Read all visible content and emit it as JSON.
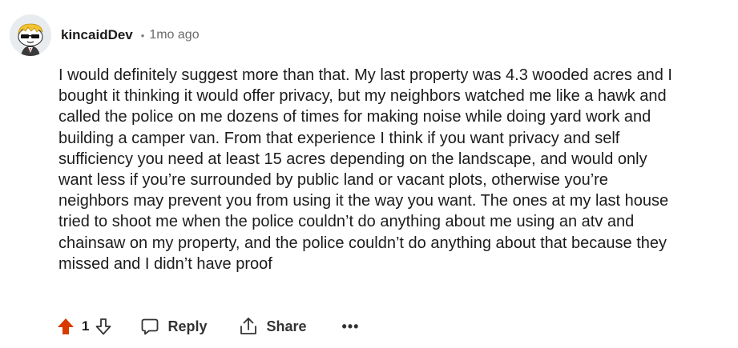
{
  "comment": {
    "author": "kincaidDev",
    "separator": "•",
    "time_ago": "1mo ago",
    "body": "I would definitely suggest more than that. My last property was 4.3 wooded acres and I\nbought it thinking it would offer privacy, but my neighbors watched me like a hawk and\ncalled the police on me dozens of times for making noise while doing yard work and\nbuilding a camper van. From that experience I think if you want privacy and self\nsufficiency you need at least 15 acres depending on the landscape, and would only\nwant less if you’re surrounded by public land or vacant plots, otherwise you’re\nneighbors may prevent you from using it the way you want. The ones at my last house\ntried to shoot me when the police couldn’t do anything about me using an atv and\nchainsaw on my property, and the police couldn’t do anything about that because they\nmissed and I didn’t have proof",
    "vote_count": "1"
  },
  "actions": {
    "reply_label": "Reply",
    "share_label": "Share",
    "more_label": "•••"
  },
  "colors": {
    "upvote_active": "#d93a00",
    "text": "#1c1c1c",
    "muted": "#6a6a6a"
  },
  "icons": {
    "avatar": "snoo-avatar-with-sunglasses",
    "upvote": "upvote-arrow-icon",
    "downvote": "downvote-arrow-icon",
    "reply": "speech-bubble-icon",
    "share": "share-icon",
    "more": "ellipsis-icon"
  }
}
